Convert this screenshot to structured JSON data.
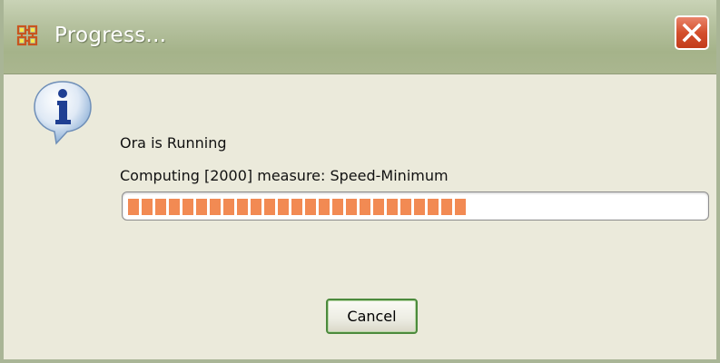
{
  "window": {
    "title": "Progress...",
    "app_icon": "ora-network-icon",
    "close_icon": "close-x-icon"
  },
  "message": {
    "icon": "info-icon",
    "line1": "Ora is Running",
    "line2": "Computing [2000] measure: Speed-Minimum"
  },
  "progress": {
    "percent": 60,
    "color": "#f28a53"
  },
  "buttons": {
    "cancel_label": "Cancel"
  },
  "colors": {
    "titlebar": "#b5c19e",
    "close_button": "#d4502d",
    "dialog_bg": "#ebeadb",
    "focus_border": "#4b8a3c"
  }
}
